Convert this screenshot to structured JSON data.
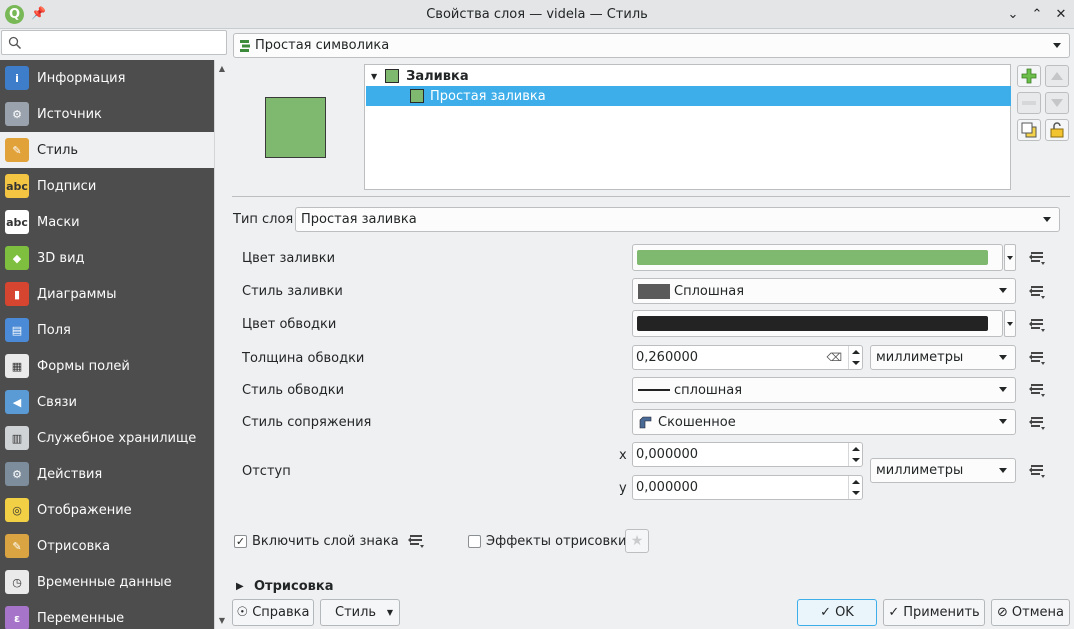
{
  "window": {
    "title": "Свойства слоя — videla — Стиль",
    "app_icon": "Q"
  },
  "sidebar": {
    "search_placeholder": "",
    "items": [
      {
        "label": "Информация",
        "icon": "info-icon",
        "color": "#3d7dca"
      },
      {
        "label": "Источник",
        "icon": "source-icon",
        "color": "#9aa3ad"
      },
      {
        "label": "Стиль",
        "icon": "paintbrush-icon",
        "color": "#e1a23a"
      },
      {
        "label": "Подписи",
        "icon": "labels-icon",
        "color": "#f4c542"
      },
      {
        "label": "Маски",
        "icon": "masks-icon",
        "color": "#ffffff"
      },
      {
        "label": "3D вид",
        "icon": "3d-icon",
        "color": "#7fbf3f"
      },
      {
        "label": "Диаграммы",
        "icon": "diagrams-icon",
        "color": "#d6452f"
      },
      {
        "label": "Поля",
        "icon": "fields-icon",
        "color": "#4b8ad6"
      },
      {
        "label": "Формы полей",
        "icon": "forms-icon",
        "color": "#eaeaea"
      },
      {
        "label": "Связи",
        "icon": "relations-icon",
        "color": "#5b9bd5"
      },
      {
        "label": "Служебное хранилище",
        "icon": "storage-icon",
        "color": "#cfd3d6"
      },
      {
        "label": "Действия",
        "icon": "actions-icon",
        "color": "#7d8d9c"
      },
      {
        "label": "Отображение",
        "icon": "display-icon",
        "color": "#f2d045"
      },
      {
        "label": "Отрисовка",
        "icon": "rendering-icon",
        "color": "#d9a441"
      },
      {
        "label": "Временные данные",
        "icon": "temporal-icon",
        "color": "#eaeaea"
      },
      {
        "label": "Переменные",
        "icon": "variables-icon",
        "color": "#a675c9"
      }
    ],
    "active_index": 2
  },
  "renderer": {
    "label": "Простая символика"
  },
  "symbol_tree": {
    "root": "Заливка",
    "child": "Простая заливка"
  },
  "layer_type": {
    "label": "Тип слоя",
    "value": "Простая заливка"
  },
  "props": {
    "fill_color": {
      "label": "Цвет заливки",
      "color": "#7fb86f"
    },
    "fill_style": {
      "label": "Стиль заливки",
      "value": "Сплошная",
      "swatch": "#5a5a5a"
    },
    "stroke_color": {
      "label": "Цвет обводки",
      "color": "#232323"
    },
    "stroke_width": {
      "label": "Толщина обводки",
      "value": "0,260000",
      "unit": "миллиметры"
    },
    "stroke_style": {
      "label": "Стиль обводки",
      "value": "сплошная"
    },
    "join_style": {
      "label": "Стиль сопряжения",
      "value": "Скошенное"
    },
    "offset": {
      "label": "Отступ",
      "x_label": "x",
      "x": "0,000000",
      "y_label": "y",
      "y": "0,000000",
      "unit": "миллиметры"
    }
  },
  "enable_layer": {
    "label": "Включить слой знака",
    "checked": true
  },
  "draw_effects": {
    "label": "Эффекты отрисовки",
    "checked": false
  },
  "rendering_section": "Отрисовка",
  "buttons": {
    "help": "Справка",
    "style": "Стиль",
    "ok": "OK",
    "apply": "Применить",
    "cancel": "Отмена"
  }
}
